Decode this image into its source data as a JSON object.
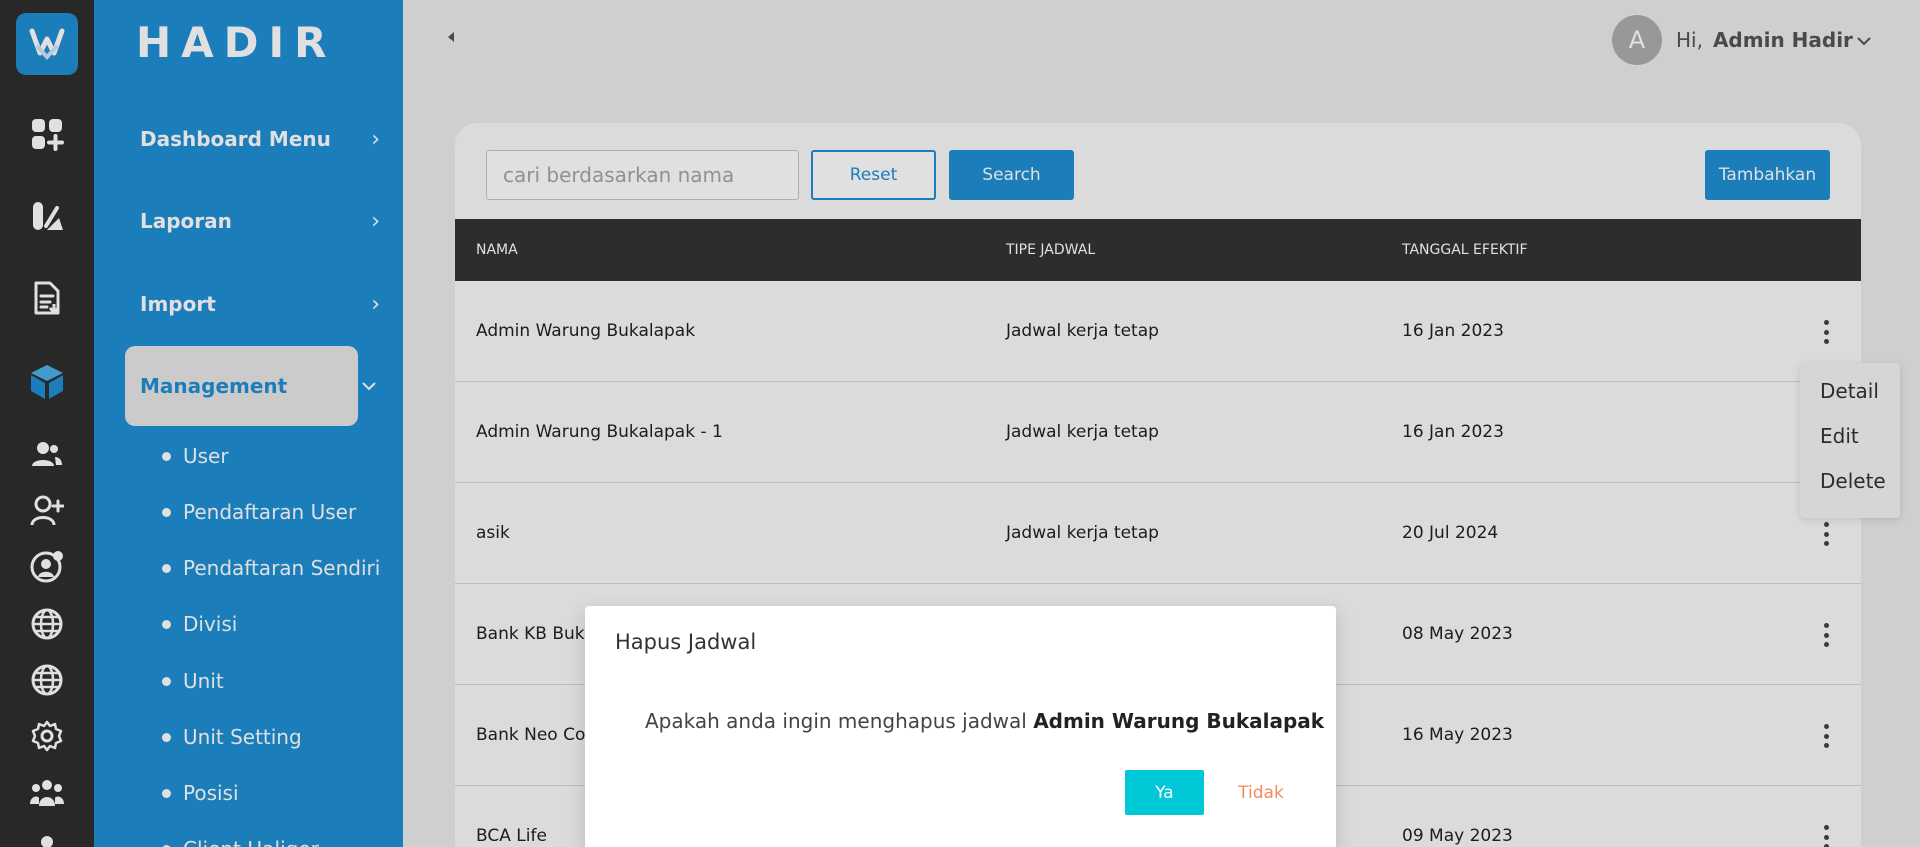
{
  "brand": "HADIR",
  "colors": {
    "primary": "#1f8fd4",
    "rail": "#2e2e2e",
    "table_header": "#343434",
    "confirm": "#00c8d7",
    "cancel": "#f38b5f"
  },
  "rail_icons": [
    "logo-icon",
    "apps-add-icon",
    "draw-tool-icon",
    "file-document-icon",
    "cube-icon",
    "users-icon",
    "user-add-icon",
    "user-gear-icon",
    "globe-icon",
    "globe-alt-icon",
    "settings-icon",
    "team-icon",
    "person-icon"
  ],
  "sidebar": {
    "menu": [
      {
        "label": "Dashboard Menu"
      },
      {
        "label": "Laporan"
      },
      {
        "label": "Import"
      }
    ],
    "active": {
      "label": "Management"
    },
    "sub_items": [
      {
        "label": "User"
      },
      {
        "label": "Pendaftaran User"
      },
      {
        "label": "Pendaftaran Sendiri"
      },
      {
        "label": "Divisi"
      },
      {
        "label": "Unit"
      },
      {
        "label": "Unit Setting"
      },
      {
        "label": "Posisi"
      },
      {
        "label": "Client Haliger"
      }
    ]
  },
  "header": {
    "avatar_initial": "A",
    "greeting": "Hi,",
    "username": "Admin Hadir"
  },
  "toolbar": {
    "search_placeholder": "cari berdasarkan nama",
    "reset_label": "Reset",
    "search_label": "Search",
    "add_label": "Tambahkan"
  },
  "table": {
    "columns": [
      "NAMA",
      "TIPE JADWAL",
      "TANGGAL EFEKTIF"
    ],
    "rows": [
      {
        "nama": "Admin Warung Bukalapak",
        "tipe": "Jadwal kerja tetap",
        "tanggal": "16 Jan 2023"
      },
      {
        "nama": "Admin Warung Bukalapak - 1",
        "tipe": "Jadwal kerja tetap",
        "tanggal": "16 Jan 2023"
      },
      {
        "nama": "asik",
        "tipe": "Jadwal kerja tetap",
        "tanggal": "20 Jul 2024"
      },
      {
        "nama": "Bank KB Bukopin",
        "tipe": "",
        "tanggal": "08 May 2023"
      },
      {
        "nama": "Bank Neo Commerce",
        "tipe": "",
        "tanggal": "16 May 2023"
      },
      {
        "nama": "BCA Life",
        "tipe": "",
        "tanggal": "09 May 2023"
      }
    ]
  },
  "row_menu": {
    "items": [
      "Detail",
      "Edit",
      "Delete"
    ]
  },
  "modal": {
    "title": "Hapus Jadwal",
    "message": "Apakah anda ingin menghapus jadwal",
    "target": "Admin Warung Bukalapak",
    "confirm_label": "Ya",
    "cancel_label": "Tidak"
  }
}
